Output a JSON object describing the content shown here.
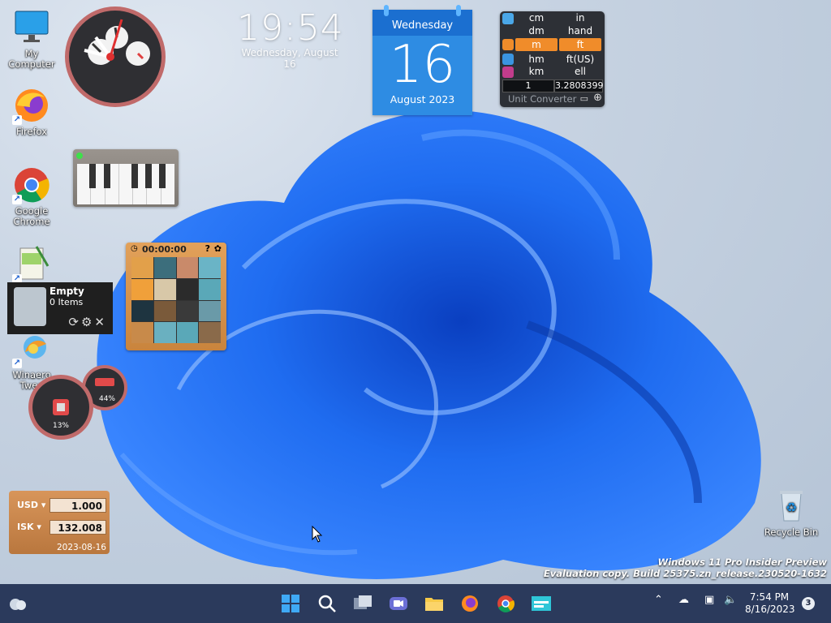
{
  "desktop_icons": [
    {
      "label": "My Computer"
    },
    {
      "label": "Firefox"
    },
    {
      "label": "Google Chrome"
    },
    {
      "label": ""
    },
    {
      "label": "Winaero Twea"
    },
    {
      "label": "Recycle Bin"
    }
  ],
  "clock_widget": {
    "time": "19:54",
    "date": "Wednesday, August 16"
  },
  "calendar_widget": {
    "weekday": "Wednesday",
    "day": "16",
    "month_year": "August 2023"
  },
  "unit_converter": {
    "rows": [
      [
        "cm",
        "in"
      ],
      [
        "dm",
        "hand"
      ],
      [
        "m",
        "ft"
      ],
      [
        "hm",
        "ft(US)"
      ],
      [
        "km",
        "ell"
      ]
    ],
    "input_value": "1",
    "output_value": "3.2808399",
    "title": "Unit Converter"
  },
  "puzzle": {
    "timer": "00:00:00"
  },
  "recycle_popup": {
    "status": "Empty",
    "items": "0 Items"
  },
  "meters": {
    "small_percent": "44%",
    "large_percent": "13%"
  },
  "currency": {
    "from_code": "USD",
    "from_value": "1.000",
    "to_code": "ISK",
    "to_value": "132.008",
    "date": "2023-08-16"
  },
  "watermark": {
    "line1": "Windows 11 Pro Insider Preview",
    "line2": "Evaluation copy. Build 25375.zn_release.230520-1632"
  },
  "taskbar": {
    "time": "7:54 PM",
    "date": "8/16/2023",
    "notification_count": "3"
  },
  "colors": {
    "accent": "#f08c2a",
    "taskbar": "#2b3a5c",
    "calendar": "#2e8ce3"
  }
}
